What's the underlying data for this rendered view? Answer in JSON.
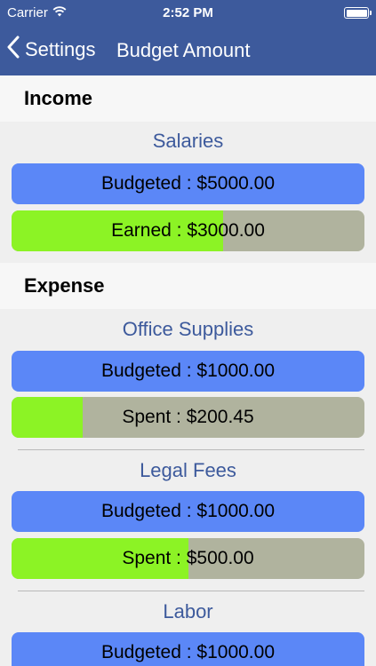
{
  "status_bar": {
    "carrier": "Carrier",
    "time": "2:52 PM"
  },
  "nav": {
    "back_label": "Settings",
    "title": "Budget Amount"
  },
  "colors": {
    "nav_background": "#3d5a9c",
    "title_text": "#3d5a9c",
    "budget_bar": "#5b87f7",
    "progress_fill": "#8cf325",
    "progress_track": "#b0b39e"
  },
  "income": {
    "header": "Income",
    "items": [
      {
        "title": "Salaries",
        "budgeted": "Budgeted : $5000.00",
        "actual": "Earned : $3000.00",
        "actual_fraction": 0.6
      }
    ]
  },
  "expense": {
    "header": "Expense",
    "items": [
      {
        "title": "Office Supplies",
        "budgeted": "Budgeted : $1000.00",
        "actual": "Spent : $200.45",
        "actual_fraction": 0.20045
      },
      {
        "title": "Legal Fees",
        "budgeted": "Budgeted : $1000.00",
        "actual": "Spent : $500.00",
        "actual_fraction": 0.5
      },
      {
        "title": "Labor",
        "budgeted": "Budgeted : $1000.00"
      }
    ]
  }
}
